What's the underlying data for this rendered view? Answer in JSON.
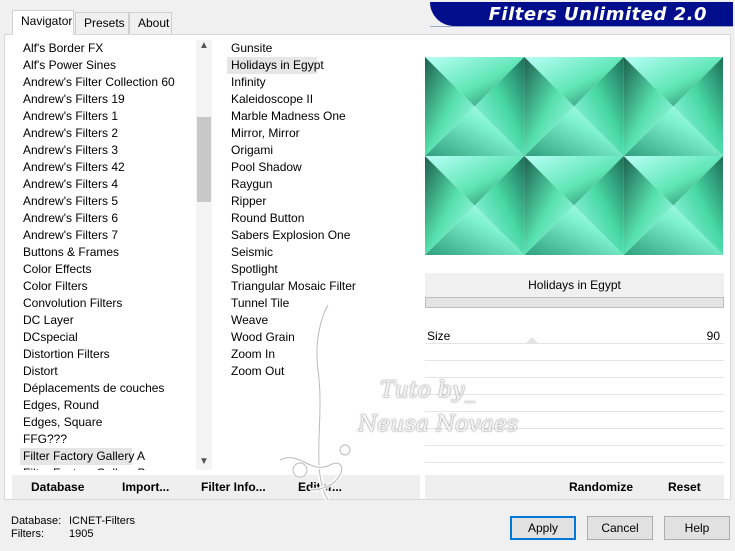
{
  "tabs": [
    "Navigator",
    "Presets",
    "About"
  ],
  "brand": "Filters Unlimited 2.0",
  "categories": [
    "Alf's Border FX",
    "Alf's Power Sines",
    "Andrew's Filter Collection 60",
    "Andrew's Filters 19",
    "Andrew's Filters 1",
    "Andrew's Filters 2",
    "Andrew's Filters 3",
    "Andrew's Filters 42",
    "Andrew's Filters 4",
    "Andrew's Filters 5",
    "Andrew's Filters 6",
    "Andrew's Filters 7",
    "Buttons & Frames",
    "Color Effects",
    "Color Filters",
    "Convolution Filters",
    "DC Layer",
    "DCspecial",
    "Distortion Filters",
    "Distort",
    "Déplacements de couches",
    "Edges, Round",
    "Edges, Square",
    "FFG???",
    "Filter Factory Gallery A",
    "Filter Factory Gallery B"
  ],
  "selected_category": "Filter Factory Gallery A",
  "filters": [
    "Gunsite",
    "Holidays in Egypt",
    "Infinity",
    "Kaleidoscope II",
    "Marble Madness One",
    "Mirror, Mirror",
    "Origami",
    "Pool Shadow",
    "Raygun",
    "Ripper",
    "Round Button",
    "Sabers Explosion One",
    "Seismic",
    "Spotlight",
    "Triangular Mosaic Filter",
    "Tunnel Tile",
    "Weave",
    "Wood Grain",
    "Zoom In",
    "Zoom Out"
  ],
  "selected_filter": "Holidays in Egypt",
  "filter_name": "Holidays in Egypt",
  "param": {
    "label": "Size",
    "value": "90"
  },
  "buttons": {
    "database": "Database",
    "import": "Import...",
    "filter_info": "Filter Info...",
    "editor": "Editor...",
    "randomize": "Randomize",
    "reset": "Reset",
    "apply": "Apply",
    "cancel": "Cancel",
    "help": "Help"
  },
  "info": {
    "db_label": "Database:",
    "db_value": "ICNET-Filters",
    "filters_label": "Filters:",
    "filters_value": "1905"
  },
  "watermark": {
    "line1": "Tuto by_",
    "line2": "Neusa Novaes"
  },
  "colors": {
    "brand_bg": "#000e8c",
    "preview_light": "#b8fff6",
    "preview_dark": "#1d6e56"
  }
}
